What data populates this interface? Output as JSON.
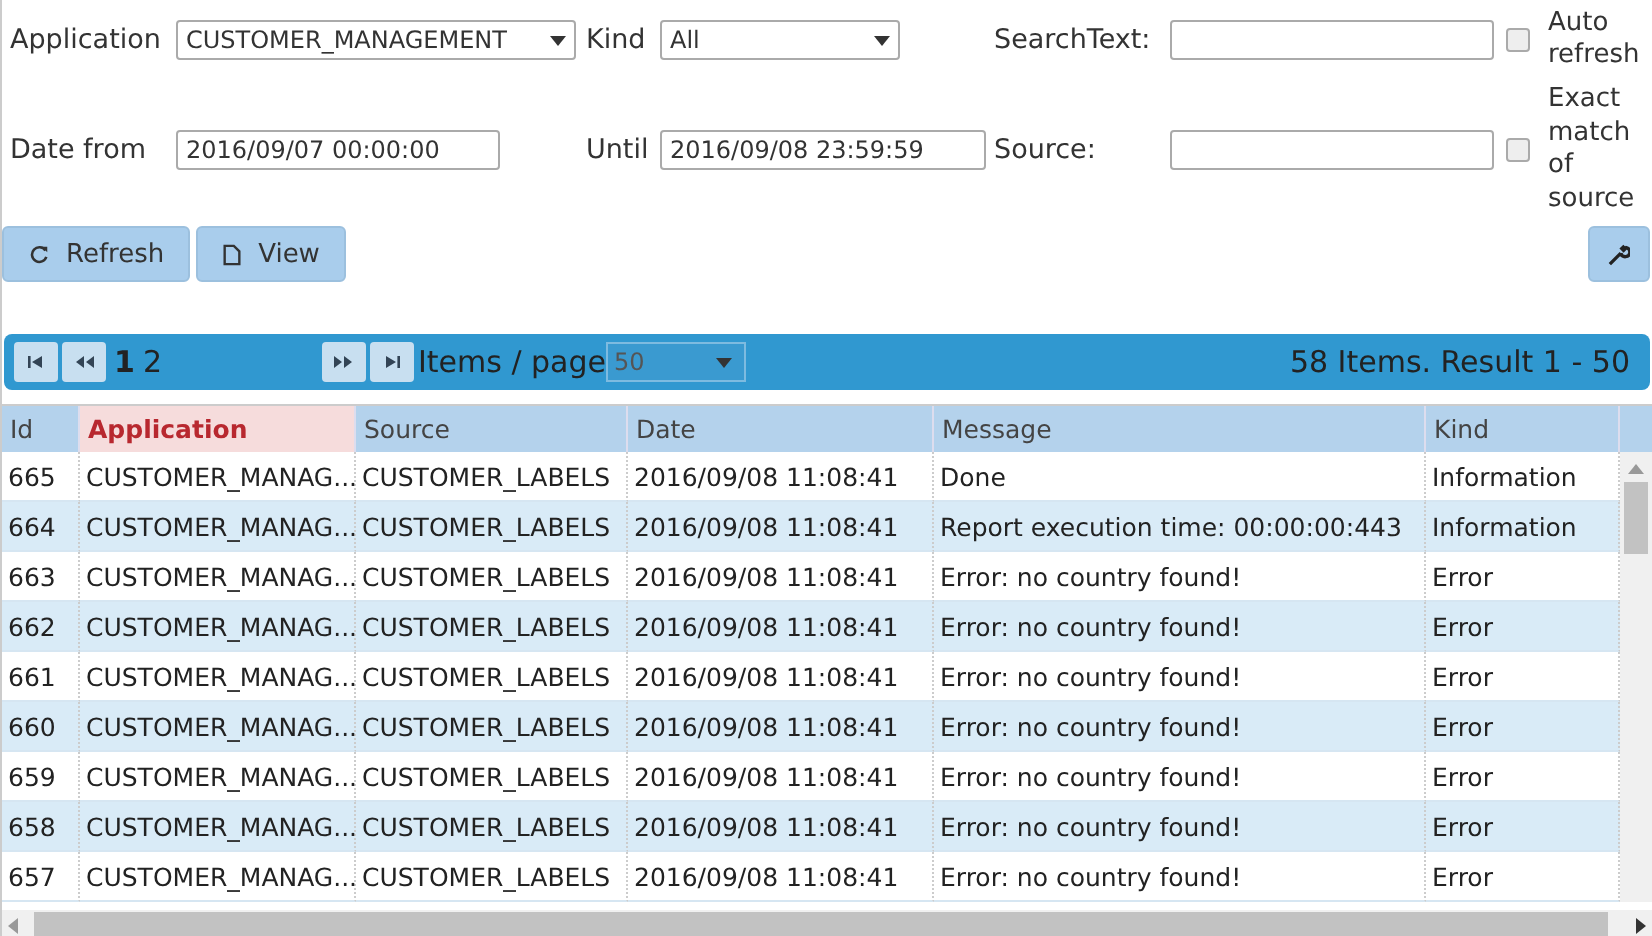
{
  "filters": {
    "application": {
      "label": "Application",
      "value": "CUSTOMER_MANAGEMENT"
    },
    "kind": {
      "label": "Kind",
      "value": "All"
    },
    "search_text": {
      "label": "SearchText:"
    },
    "auto_refresh": {
      "label": "Auto refresh",
      "checked": false
    },
    "date_from": {
      "label": "Date from",
      "value": "2016/09/07 00:00:00"
    },
    "until": {
      "label": "Until",
      "value": "2016/09/08 23:59:59"
    },
    "source": {
      "label": "Source:"
    },
    "exact_match": {
      "label": "Exact match of source",
      "checked": false
    }
  },
  "buttons": [
    {
      "label": "Refresh"
    },
    {
      "label": "View"
    }
  ],
  "pager": {
    "pages": [
      {
        "label": "1",
        "selected": true
      },
      {
        "label": "2",
        "selected": false
      }
    ],
    "items_per_page_label": "Items / page",
    "items_per_page": "50",
    "summary": "58 Items. Result 1 - 50"
  },
  "table": {
    "columns": [
      {
        "label": "Id",
        "sorted": false
      },
      {
        "label": "Application",
        "sorted": true
      },
      {
        "label": "Source",
        "sorted": false
      },
      {
        "label": "Date",
        "sorted": false
      },
      {
        "label": "Message",
        "sorted": false
      },
      {
        "label": "Kind",
        "sorted": false
      }
    ],
    "rows": [
      [
        "665",
        "CUSTOMER_MANAG...",
        "CUSTOMER_LABELS",
        "2016/09/08 11:08:41",
        "Done",
        "Information"
      ],
      [
        "664",
        "CUSTOMER_MANAG...",
        "CUSTOMER_LABELS",
        "2016/09/08 11:08:41",
        "Report execution time: 00:00:00:443",
        "Information"
      ],
      [
        "663",
        "CUSTOMER_MANAG...",
        "CUSTOMER_LABELS",
        "2016/09/08 11:08:41",
        "Error: no country found!",
        "Error"
      ],
      [
        "662",
        "CUSTOMER_MANAG...",
        "CUSTOMER_LABELS",
        "2016/09/08 11:08:41",
        "Error: no country found!",
        "Error"
      ],
      [
        "661",
        "CUSTOMER_MANAG...",
        "CUSTOMER_LABELS",
        "2016/09/08 11:08:41",
        "Error: no country found!",
        "Error"
      ],
      [
        "660",
        "CUSTOMER_MANAG...",
        "CUSTOMER_LABELS",
        "2016/09/08 11:08:41",
        "Error: no country found!",
        "Error"
      ],
      [
        "659",
        "CUSTOMER_MANAG...",
        "CUSTOMER_LABELS",
        "2016/09/08 11:08:41",
        "Error: no country found!",
        "Error"
      ],
      [
        "658",
        "CUSTOMER_MANAG...",
        "CUSTOMER_LABELS",
        "2016/09/08 11:08:41",
        "Error: no country found!",
        "Error"
      ],
      [
        "657",
        "CUSTOMER_MANAG...",
        "CUSTOMER_LABELS",
        "2016/09/08 11:08:41",
        "Error: no country found!",
        "Error"
      ]
    ]
  }
}
